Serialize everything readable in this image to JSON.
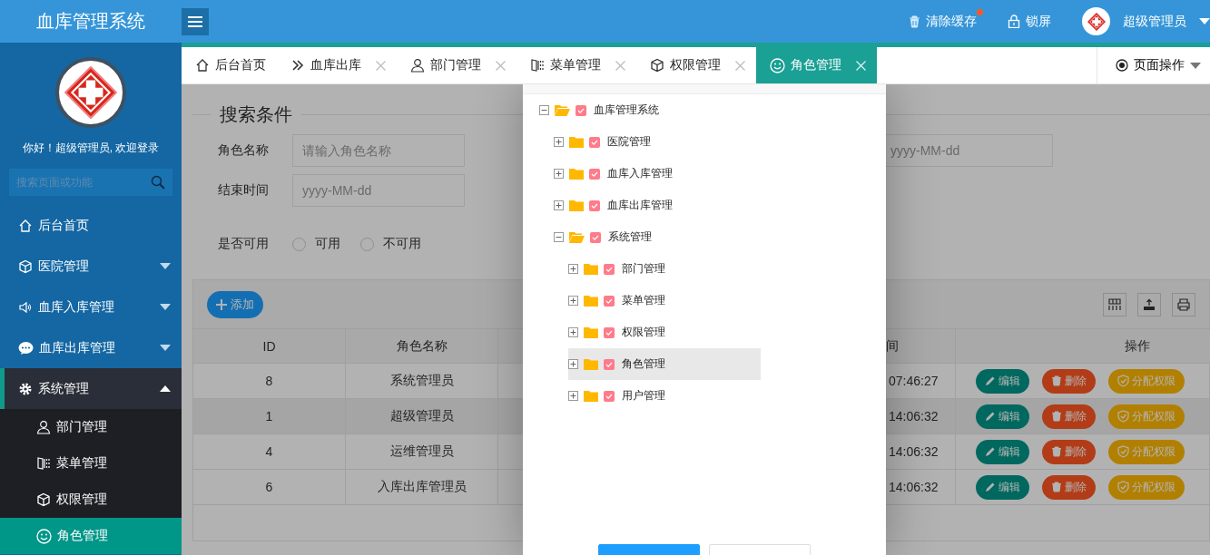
{
  "header": {
    "title": "血库管理系统",
    "actions": [
      {
        "kind": "clear-cache",
        "label": "清除缓存",
        "badge": true
      },
      {
        "kind": "lock",
        "label": "锁屏"
      }
    ],
    "user": {
      "name": "超级管理员"
    }
  },
  "sidebar": {
    "greeting": "你好！超级管理员, 欢迎登录",
    "search": {
      "placeholder": "搜索页面或功能"
    },
    "items": [
      {
        "label": "后台首页",
        "selected": false
      },
      {
        "label": "医院管理",
        "selected": false,
        "expanded": false
      },
      {
        "label": "血库入库管理",
        "selected": false,
        "expanded": false
      },
      {
        "label": "血库出库管理",
        "selected": false,
        "expanded": false
      },
      {
        "label": "系统管理",
        "selected": false,
        "expanded": true,
        "children": [
          {
            "label": "部门管理",
            "selected": false
          },
          {
            "label": "菜单管理",
            "selected": false
          },
          {
            "label": "权限管理",
            "selected": false
          },
          {
            "label": "角色管理",
            "selected": true
          }
        ]
      }
    ]
  },
  "tabs": [
    {
      "label": "后台首页",
      "selected": false,
      "closable": false
    },
    {
      "label": "血库出库",
      "selected": false,
      "closable": true
    },
    {
      "label": "部门管理",
      "selected": false,
      "closable": true
    },
    {
      "label": "菜单管理",
      "selected": false,
      "closable": true
    },
    {
      "label": "权限管理",
      "selected": false,
      "closable": true
    },
    {
      "label": "角色管理",
      "selected": true,
      "closable": true
    }
  ],
  "page_actions": "页面操作",
  "search": {
    "legend": "搜索条件",
    "rows": [
      [
        {
          "label": "角色名称",
          "placeholder": "请输入角色名称"
        },
        {
          "placeholder": "yyyy-MM-dd"
        }
      ],
      [
        {
          "label": "结束时间",
          "placeholder": "yyyy-MM-dd"
        }
      ]
    ],
    "radio": {
      "label": "是否可用",
      "options": [
        {
          "label": "可用",
          "selected": false
        },
        {
          "label": "不可用",
          "selected": false
        }
      ]
    }
  },
  "table": {
    "add_button": "添加",
    "columns": {
      "id": "ID",
      "role_name": "角色名称",
      "column_4": "间",
      "actions": "操作"
    },
    "rows": [
      {
        "id": "8",
        "role_name": "系统管理员",
        "column_4": "07:46:27",
        "hovered": false,
        "actions": [
          {
            "kind": "edit",
            "label": "编辑"
          },
          {
            "kind": "delete",
            "label": "删除"
          },
          {
            "kind": "assign",
            "label": "分配权限"
          }
        ]
      },
      {
        "id": "1",
        "role_name": "超级管理员",
        "column_4": "14:06:32",
        "hovered": true,
        "actions": [
          {
            "kind": "edit",
            "label": "编辑"
          },
          {
            "kind": "delete",
            "label": "删除"
          },
          {
            "kind": "assign",
            "label": "分配权限"
          }
        ]
      },
      {
        "id": "4",
        "role_name": "运维管理员",
        "column_4": "14:06:32",
        "hovered": false,
        "actions": [
          {
            "kind": "edit",
            "label": "编辑"
          },
          {
            "kind": "delete",
            "label": "删除"
          },
          {
            "kind": "assign",
            "label": "分配权限"
          }
        ]
      },
      {
        "id": "6",
        "role_name": "入库出库管理员",
        "column_4": "14:06:32",
        "hovered": false,
        "actions": [
          {
            "kind": "edit",
            "label": "编辑"
          },
          {
            "kind": "delete",
            "label": "删除"
          },
          {
            "kind": "assign",
            "label": "分配权限"
          }
        ]
      }
    ]
  },
  "dialog": {
    "tree": [
      {
        "label": "血库管理系统",
        "expanded": true,
        "checked": true,
        "selected": false,
        "children": [
          {
            "label": "医院管理",
            "expanded": false,
            "checked": true,
            "selected": false
          },
          {
            "label": "血库入库管理",
            "expanded": false,
            "checked": true,
            "selected": false
          },
          {
            "label": "血库出库管理",
            "expanded": false,
            "checked": true,
            "selected": false
          },
          {
            "label": "系统管理",
            "expanded": true,
            "checked": true,
            "selected": false,
            "children": [
              {
                "label": "部门管理",
                "expanded": false,
                "checked": true,
                "selected": false
              },
              {
                "label": "菜单管理",
                "expanded": false,
                "checked": true,
                "selected": false
              },
              {
                "label": "权限管理",
                "expanded": false,
                "checked": true,
                "selected": false
              },
              {
                "label": "角色管理",
                "expanded": false,
                "checked": true,
                "selected": true
              },
              {
                "label": "用户管理",
                "expanded": false,
                "checked": true,
                "selected": false
              }
            ]
          }
        ]
      }
    ],
    "buttons": [
      {
        "kind": "primary"
      },
      {
        "kind": "default"
      }
    ]
  }
}
